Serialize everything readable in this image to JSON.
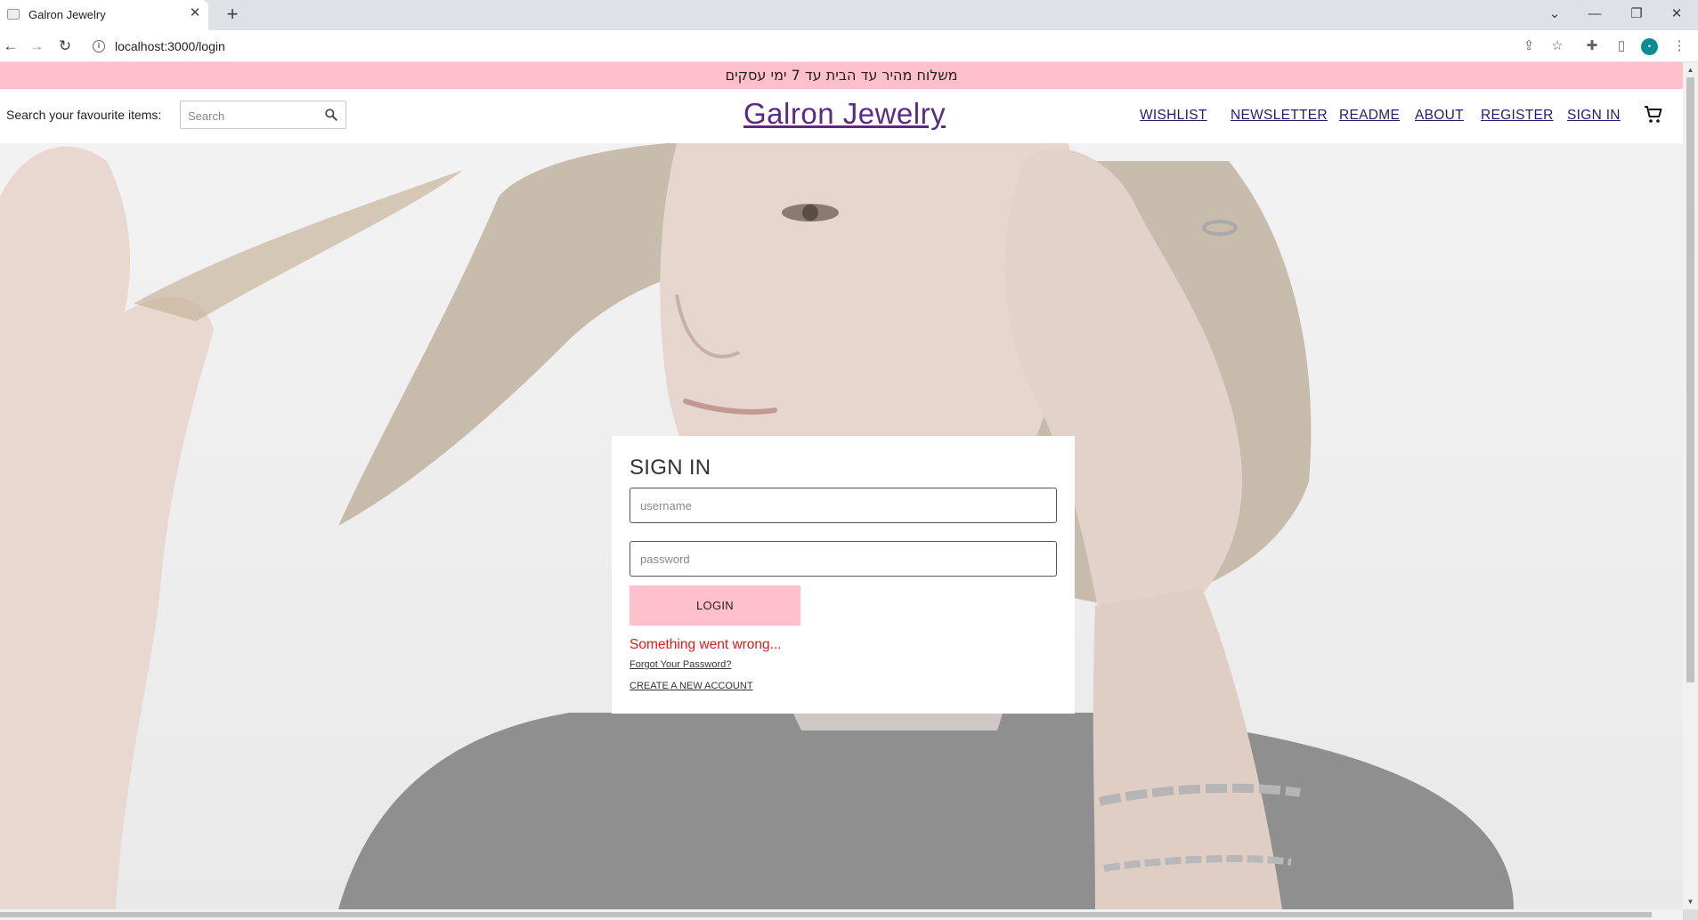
{
  "browser": {
    "tab_title": "Galron Jewelry",
    "tab_close": "✕",
    "new_tab": "+",
    "url": "localhost:3000/login",
    "window": {
      "minimize": "—",
      "restore": "❐",
      "close": "✕",
      "tab_list": "⌄"
    },
    "nav": {
      "back": "←",
      "forward": "→",
      "reload": "↻"
    },
    "toolbar": {
      "share": "⇪",
      "bookmark": "☆",
      "extensions": "✚",
      "side_panel": "▯",
      "menu": "⋮"
    }
  },
  "promo": {
    "text": "משלוח מהיר עד הבית עד 7 ימי עסקים"
  },
  "header": {
    "search_label": "Search your favourite items:",
    "search_placeholder": "Search",
    "brand": "Galron Jewelry",
    "nav": [
      "WISHLIST",
      "NEWSLETTER",
      "README",
      "ABOUT",
      "REGISTER",
      "SIGN IN"
    ]
  },
  "signin": {
    "title": "SIGN IN",
    "username_placeholder": "username",
    "password_placeholder": "password",
    "login_label": "LOGIN",
    "error": "Something went wrong...",
    "forgot": "Forgot Your Password?",
    "create": "CREATE A NEW ACCOUNT"
  },
  "colors": {
    "promo_bg": "#ffc0cb",
    "brand": "#5b2a86",
    "error": "#e01b1b",
    "button_bg": "#ffc0cb"
  }
}
